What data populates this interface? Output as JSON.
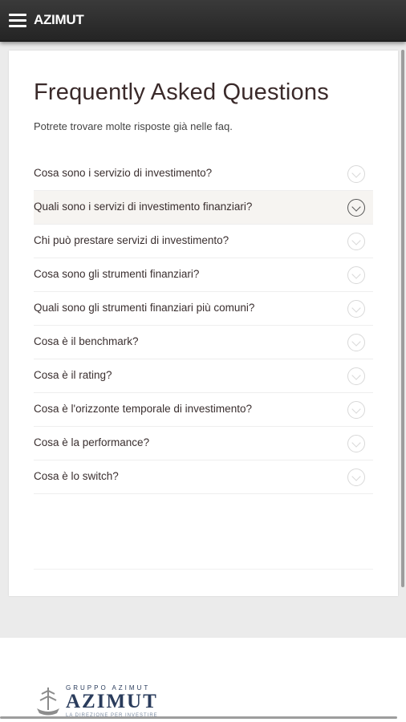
{
  "header": {
    "brand": "AZIMUT",
    "menu_icon": "hamburger-menu-icon"
  },
  "main": {
    "title": "Frequently Asked Questions",
    "subtitle": "Potrete trovare molte risposte già nelle faq.",
    "faq": [
      {
        "question": "Cosa sono i servizio di investimento?",
        "active": false
      },
      {
        "question": "Quali sono i servizi di investimento finanziari?",
        "active": true
      },
      {
        "question": "Chi può prestare servizi di investimento?",
        "active": false
      },
      {
        "question": "Cosa sono gli strumenti finanziari?",
        "active": false
      },
      {
        "question": "Quali sono gli strumenti finanziari più comuni?",
        "active": false
      },
      {
        "question": "Cosa è il benchmark?",
        "active": false
      },
      {
        "question": "Cosa è il rating?",
        "active": false
      },
      {
        "question": "Cosa è l'orizzonte temporale di investimento?",
        "active": false
      },
      {
        "question": "Cosa è la performance?",
        "active": false
      },
      {
        "question": "Cosa è lo switch?",
        "active": false
      }
    ]
  },
  "footer": {
    "logo_group": "GRUPPO AZIMUT",
    "logo_name": "AZIMUT",
    "logo_tagline": "LA DIREZIONE PER INVESTIRE"
  },
  "colors": {
    "topbar": "#2e2e2e",
    "title": "#3a2a2a",
    "logo": "#2a3c5c",
    "active_row": "#f6f4f1"
  }
}
